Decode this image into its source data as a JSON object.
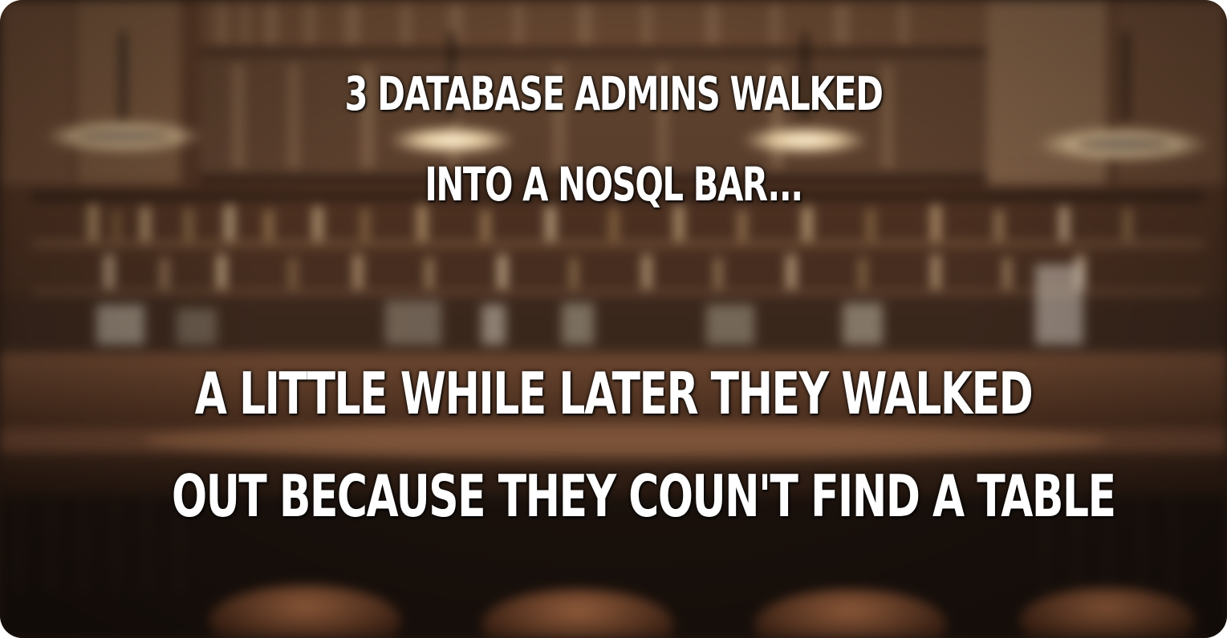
{
  "meme": {
    "top_lines": [
      "3 DATABASE ADMINS WALKED",
      "INTO A NOSQL BAR..."
    ],
    "bottom_lines": [
      "A LITTLE WHILE LATER THEY WALKED",
      "OUT BECAUSE THEY COUN'T FIND A TABLE"
    ]
  },
  "colors": {
    "caption_text": "#ffffff",
    "background_wood": "#3a2518",
    "lamp_glow": "#f3e2c4"
  },
  "icons": [
    "blurred-bar-background"
  ]
}
